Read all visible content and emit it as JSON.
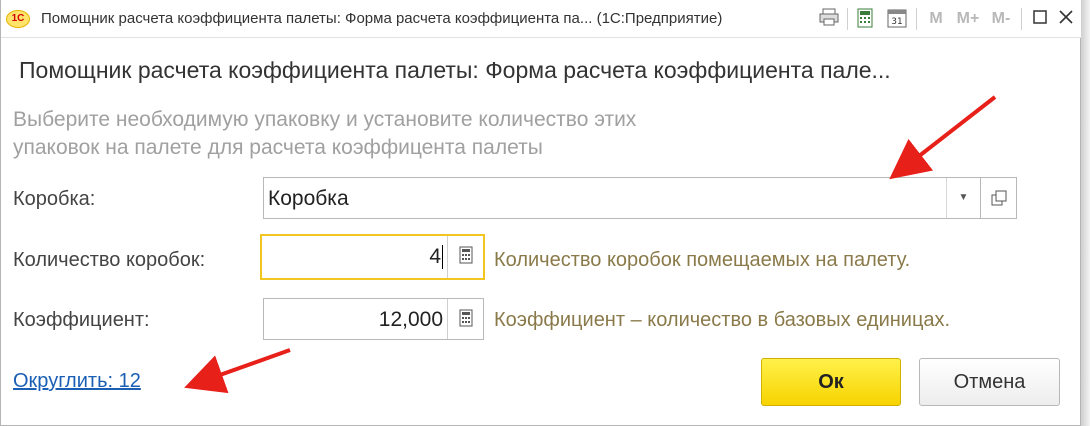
{
  "window": {
    "title": "Помощник расчета коэффициента палеты: Форма расчета коэффициента па...  (1С:Предприятие)",
    "logo_text": "1С",
    "toolbar_m_labels": [
      "M",
      "M+",
      "M-"
    ]
  },
  "form": {
    "title": "Помощник расчета коэффициента палеты: Форма расчета коэффициента пале...",
    "hint_line1": "Выберите необходимую упаковку и установите количество этих",
    "hint_line2": "упаковок на палете для расчета коэффицента палеты",
    "box": {
      "label": "Коробка:",
      "value": "Коробка"
    },
    "box_count": {
      "label": "Количество коробок:",
      "value": "4",
      "description": "Количество коробок помещаемых на палету."
    },
    "coefficient": {
      "label": "Коэффициент:",
      "value": "12,000",
      "description": "Коэффициент – количество в базовых единицах."
    },
    "round_link": "Округлить: 12",
    "ok_label": "Ок",
    "cancel_label": "Отмена"
  },
  "colors": {
    "accent_yellow": "#f7d300",
    "focus_border": "#f2c520",
    "link_blue": "#1a5fb4",
    "description_text": "#8a7a4a",
    "annotation_arrow": "#e8201a"
  }
}
